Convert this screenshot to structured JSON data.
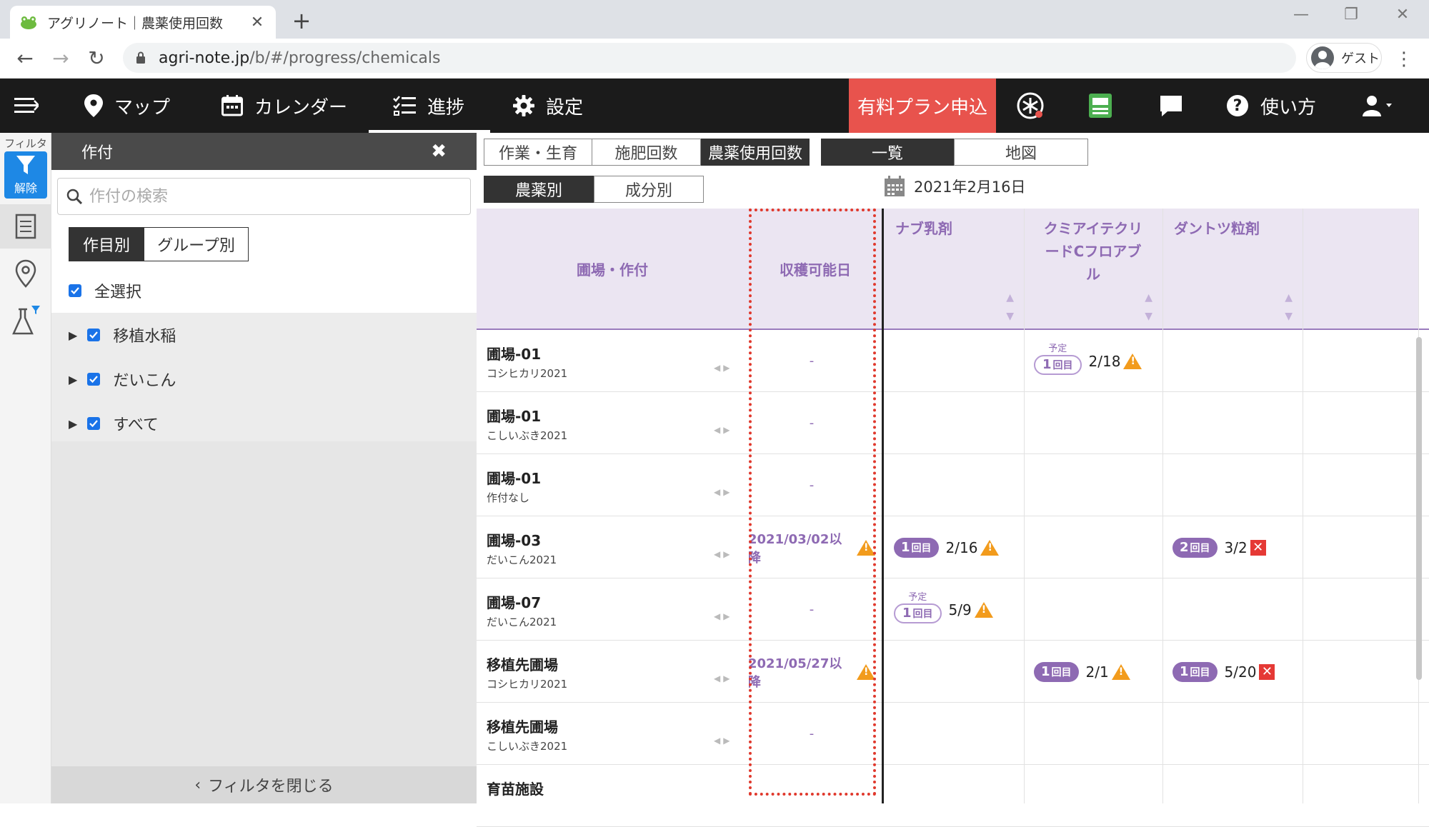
{
  "browser": {
    "tab_title": "アグリノート｜農薬使用回数",
    "url_host": "agri-note.jp",
    "url_path": "/b/#/progress/chemicals",
    "profile_label": "ゲスト"
  },
  "navbar": {
    "items": [
      {
        "label": "マップ"
      },
      {
        "label": "カレンダー"
      },
      {
        "label": "進捗"
      },
      {
        "label": "設定"
      }
    ],
    "paid_plan": "有料プラン申込",
    "help": "使い方"
  },
  "rail": {
    "filter_label": "フィルタ",
    "clear_label": "解除"
  },
  "filter": {
    "title": "作付",
    "search_placeholder": "作付の検索",
    "toggle": [
      "作目別",
      "グループ別"
    ],
    "select_all": "全選択",
    "items": [
      "移植水稲",
      "だいこん",
      "すべて"
    ],
    "close_label": "フィルタを閉じる"
  },
  "main": {
    "tabs": [
      "作業・生育",
      "施肥回数",
      "農薬使用回数"
    ],
    "views": [
      "一覧",
      "地図"
    ],
    "modes": [
      "農薬別",
      "成分別"
    ],
    "date": "2021年2月16日"
  },
  "table": {
    "col_field": "圃場・作付",
    "col_harvest": "収穫可能日",
    "chem_cols": [
      "ナブ乳剤",
      "クミアイテクリードCフロアブル",
      "ダントツ粒剤"
    ],
    "plan_label": "予定",
    "count_suffix": "回目",
    "rows": [
      {
        "field": "圃場-01",
        "crop": "コシヒカリ2021",
        "harvest": "-",
        "c2_n": "1",
        "c2_date": "2/18"
      },
      {
        "field": "圃場-01",
        "crop": "こしいぶき2021",
        "harvest": "-"
      },
      {
        "field": "圃場-01",
        "crop": "作付なし",
        "harvest": "-"
      },
      {
        "field": "圃場-03",
        "crop": "だいこん2021",
        "harvest": "2021/03/02以降",
        "c1_n": "1",
        "c1_date": "2/16",
        "c3_n": "2",
        "c3_date": "3/2"
      },
      {
        "field": "圃場-07",
        "crop": "だいこん2021",
        "harvest": "-",
        "c1_n": "1",
        "c1_date": "5/9"
      },
      {
        "field": "移植先圃場",
        "crop": "コシヒカリ2021",
        "harvest": "2021/05/27以降",
        "c2_n": "1",
        "c2_date": "2/1",
        "c3_n": "1",
        "c3_date": "5/20"
      },
      {
        "field": "移植先圃場",
        "crop": "こしいぶき2021",
        "harvest": "-"
      },
      {
        "field": "育苗施設",
        "crop": "",
        "harvest": ""
      }
    ]
  },
  "colors": {
    "accent_purple": "#8e6ab3",
    "header_bg": "#ebe5f2",
    "paid_plan": "#e8534d",
    "warning": "#f29b1c",
    "error": "#e53935",
    "highlight_border": "#e0392d"
  }
}
